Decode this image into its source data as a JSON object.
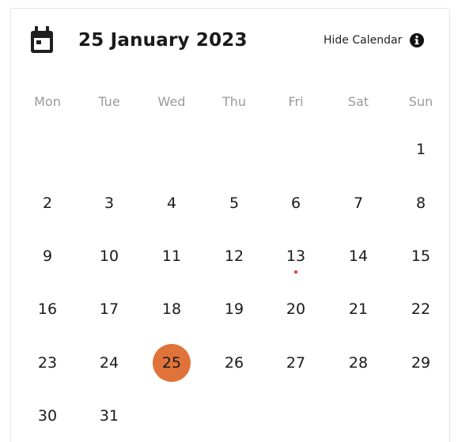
{
  "header": {
    "calendar_icon": "calendar-icon",
    "date": "25 January 2023",
    "hide_label": "Hide Calendar",
    "info_icon": "info-icon"
  },
  "weekdays": [
    "Mon",
    "Tue",
    "Wed",
    "Thu",
    "Fri",
    "Sat",
    "Sun"
  ],
  "month": {
    "first_weekday_index": 6,
    "days_in_month": 31,
    "selected_day": 25,
    "event_days": [
      13
    ]
  },
  "colors": {
    "selected": "#e0733a",
    "event_dot": "#e8322c",
    "weekday_text": "#9a9a9a"
  }
}
